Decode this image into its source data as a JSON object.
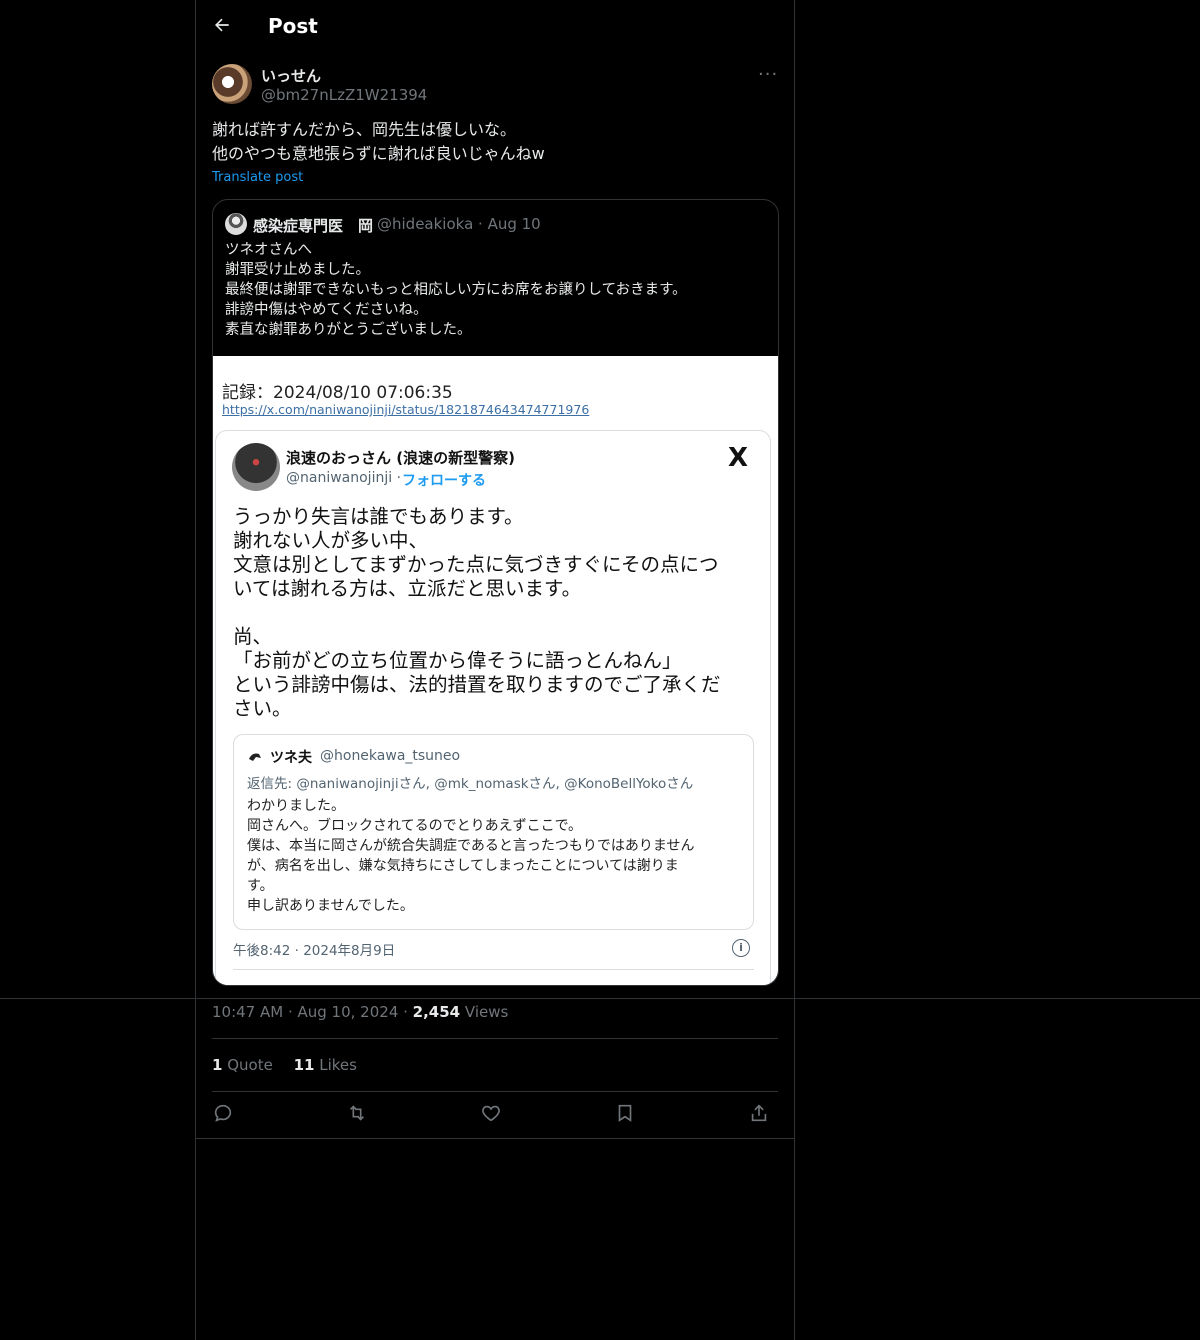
{
  "header": {
    "title": "Post"
  },
  "post": {
    "author_name": "いっせん",
    "author_handle": "@bm27nLzZ1W21394",
    "more_label": "···",
    "text": "謝れば許すんだから、岡先生は優しいな。\n他のやつも意地張らずに謝れば良いじゃんねw",
    "translate_label": "Translate post",
    "timestamp": "10:47 AM · Aug 10, 2024 · ",
    "views_count": "2,454",
    "views_label": " Views",
    "quote_count": "1",
    "quote_label": " Quote",
    "likes_count": "11",
    "likes_label": " Likes"
  },
  "quoted": {
    "author_name": "感染症専門医　岡",
    "author_handle": "@hideakioka · Aug 10",
    "text": "ツネオさんへ\n謝罪受け止めました。\n最終便は謝罪できないもっと相応しい方にお席をお譲りしておきます。\n誹謗中傷はやめてくださいね。\n素直な謝罪ありがとうございました。",
    "image": {
      "record": "記録：2024/08/10 07:06:35",
      "link": "https://x.com/naniwanojinji/status/1821874643474771976",
      "inner": {
        "name": "浪速のおっさん (浪速の新型警察)",
        "handle": "@naniwanojinji · ",
        "follow": "フォローする",
        "logo": "X",
        "text": "うっかり失言は誰でもあります。\n謝れない人が多い中、\n文意は別としてまずかった点に気づきすぐにその点につ\nいては謝れる方は、立派だと思います。\n\n尚、\n「お前がどの立ち位置から偉そうに語っとんねん」\nという誹謗中傷は、法的措置を取りますのでご了承くだ\nさい。",
        "time": "午後8:42 · 2024年8月9日",
        "info": "i",
        "nested": {
          "name": "ツネ夫",
          "handle": "@honekawa_tsuneo",
          "reply_to": "返信先: @naniwanojinjiさん, @mk_nomaskさん, @KonoBellYokoさん",
          "text": "わかりました。\n岡さんへ。ブロックされてるのでとりあえずここで。\n僕は、本当に岡さんが統合失調症であると言ったつもりではありません\nが、病名を出し、嫌な気持ちにさしてしまったことについては謝りま\nす。\n申し訳ありませんでした。"
        }
      }
    }
  },
  "icons": [
    "back-arrow-icon",
    "reply-icon",
    "repost-icon",
    "like-icon",
    "bookmark-icon",
    "share-icon"
  ],
  "colors": {
    "background": "#000000",
    "text": "#e7e9ea",
    "muted": "#71767b",
    "accent": "#1d9bf0",
    "border": "#2f3336"
  }
}
